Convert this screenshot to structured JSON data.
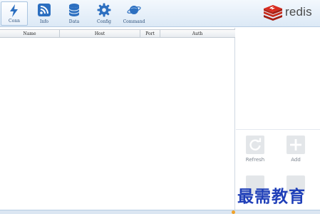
{
  "toolbar": {
    "items": [
      {
        "label": "Conn",
        "icon": "lightning-icon",
        "active": true
      },
      {
        "label": "Info",
        "icon": "rss-icon",
        "active": false
      },
      {
        "label": "Data",
        "icon": "database-icon",
        "active": false
      },
      {
        "label": "Config",
        "icon": "gear-icon",
        "active": false
      },
      {
        "label": "Command",
        "icon": "planet-icon",
        "active": false
      }
    ]
  },
  "brand": {
    "name": "redis",
    "color": "#d82c20"
  },
  "table": {
    "columns": [
      "Name",
      "Host",
      "Port",
      "Auth"
    ]
  },
  "actions": {
    "refresh_label": "Refresh",
    "add_label": "Add"
  },
  "watermark": "最需教育",
  "colors": {
    "toolbar_accent": "#2c6fc0",
    "icon_gray": "#c9cdd2",
    "watermark": "#1f3fb8"
  }
}
